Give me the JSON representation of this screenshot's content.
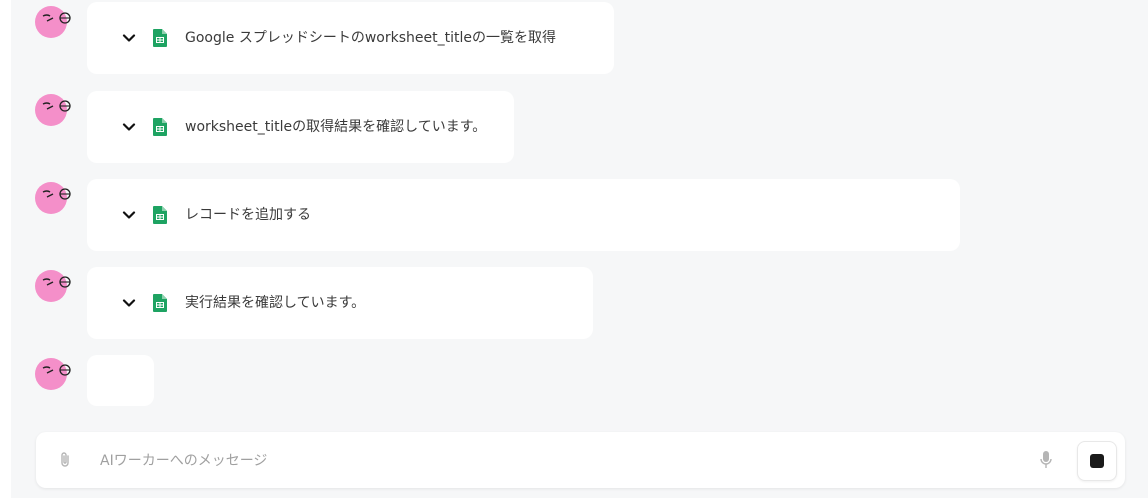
{
  "messages": [
    {
      "label": "Google スプレッドシートのworksheet_titleの一覧を取得",
      "icon": "sheets-icon"
    },
    {
      "label": "worksheet_titleの取得結果を確認しています。",
      "icon": "sheets-icon"
    },
    {
      "label": "レコードを追加する",
      "icon": "sheets-icon"
    },
    {
      "label": "実行結果を確認しています。",
      "icon": "sheets-icon"
    }
  ],
  "composer": {
    "placeholder": "AIワーカーへのメッセージ"
  },
  "colors": {
    "background": "#f6f7f8",
    "avatar": "#f48fc9",
    "sheets_green": "#1ea362",
    "bubble": "#ffffff"
  }
}
